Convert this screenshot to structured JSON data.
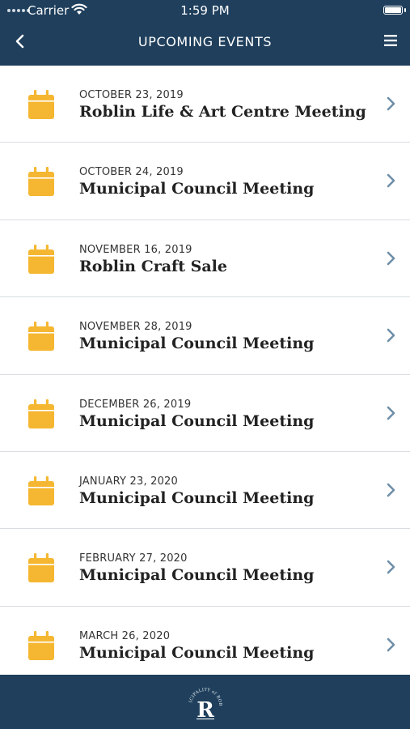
{
  "status_bar": {
    "carrier": "Carrier",
    "time": "1:59 PM"
  },
  "header": {
    "title": "UPCOMING EVENTS"
  },
  "icons": {
    "back": "chevron-left-icon",
    "menu": "hamburger-menu-icon",
    "event": "calendar-icon",
    "row_arrow": "chevron-right-icon",
    "footer_logo": "municipality-of-roblin-logo"
  },
  "colors": {
    "header_bg": "#1f3f5c",
    "calendar_icon": "#f5b731",
    "chevron": "#6f8fa8"
  },
  "events": [
    {
      "date": "OCTOBER 23, 2019",
      "title": "Roblin Life & Art Centre Meeting"
    },
    {
      "date": "OCTOBER 24, 2019",
      "title": "Municipal Council Meeting"
    },
    {
      "date": "NOVEMBER 16, 2019",
      "title": "Roblin Craft Sale"
    },
    {
      "date": "NOVEMBER 28, 2019",
      "title": "Municipal Council Meeting"
    },
    {
      "date": "DECEMBER 26, 2019",
      "title": "Municipal Council Meeting"
    },
    {
      "date": "JANUARY 23, 2020",
      "title": "Municipal Council Meeting"
    },
    {
      "date": "FEBRUARY 27, 2020",
      "title": "Municipal Council Meeting"
    },
    {
      "date": "MARCH 26, 2020",
      "title": "Municipal Council Meeting"
    }
  ],
  "footer": {
    "logo_text": "MUNICIPALITY of ROBLIN",
    "logo_letter": "R"
  }
}
